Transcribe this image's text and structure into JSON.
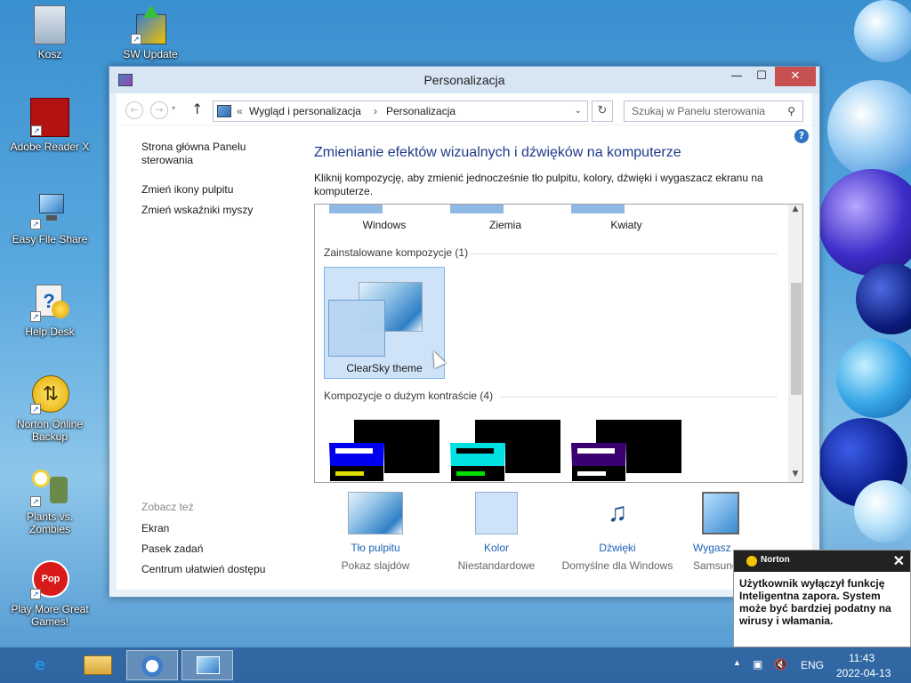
{
  "desktop": {
    "icons": [
      {
        "label": "Kosz"
      },
      {
        "label": "SW Update"
      },
      {
        "label": "Adobe Reader X"
      },
      {
        "label": "Easy File Share"
      },
      {
        "label": "Help Desk"
      },
      {
        "label": "Norton Online Backup"
      },
      {
        "label": "Plants vs. Zombies"
      },
      {
        "label": "Play More Great Games!"
      }
    ]
  },
  "window": {
    "title": "Personalizacja",
    "buttons": {
      "minimize": "—",
      "maximize": "☐",
      "close": "✕"
    }
  },
  "navbar": {
    "back": "←",
    "forward": "→",
    "up": "↑",
    "breadcrumb_prefix": "«",
    "breadcrumb": [
      "Wygląd i personalizacja",
      "Personalizacja"
    ],
    "separator": "›",
    "refresh": "↻",
    "search_placeholder": "Szukaj w Panelu sterowania"
  },
  "sidebar": {
    "links": [
      "Strona główna Panelu sterowania",
      "Zmień ikony pulpitu",
      "Zmień wskaźniki myszy"
    ],
    "see_also_title": "Zobacz też",
    "see_also": [
      "Ekran",
      "Pasek zadań",
      "Centrum ułatwień dostępu"
    ]
  },
  "main": {
    "heading": "Zmienianie efektów wizualnych i dźwięków na komputerze",
    "description": "Kliknij kompozycję, aby zmienić jednocześnie tło pulpitu, kolory, dźwięki i wygaszacz ekranu na komputerze.",
    "top_themes": [
      "Windows",
      "Ziemia",
      "Kwiaty"
    ],
    "installed_group": "Zainstalowane kompozycje (1)",
    "installed_theme": "ClearSky theme",
    "high_contrast_group": "Kompozycje o dużym kontraście (4)",
    "high_contrast_colors": [
      "#0000ee",
      "#00e0e0",
      "#3a0070"
    ]
  },
  "bottom": {
    "tiles": [
      {
        "label": "Tło pulpitu",
        "sub": "Pokaz slajdów"
      },
      {
        "label": "Kolor",
        "sub": "Niestandardowe"
      },
      {
        "label": "Dźwięki",
        "sub": "Domyślne dla Windows"
      },
      {
        "label": "Wygasz",
        "sub": "SamsungO"
      }
    ]
  },
  "norton": {
    "brand": "Norton",
    "message": "Użytkownik wyłączył funkcję Inteligentna zapora. System może być bardziej podatny na wirusy i włamania."
  },
  "taskbar": {
    "language": "ENG",
    "time": "11:43",
    "date": "2022-04-13"
  },
  "colors": {
    "accent": "#1e3a8a",
    "link": "#1d63b7",
    "close": "#c75050"
  }
}
